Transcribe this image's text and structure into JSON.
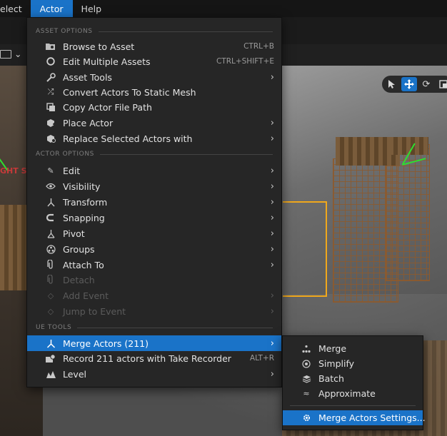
{
  "menubar": {
    "items": [
      {
        "label": "elect",
        "active": false
      },
      {
        "label": "Actor",
        "active": true
      },
      {
        "label": "Help",
        "active": false
      }
    ]
  },
  "viewport": {
    "overlay_text": "GHT SH",
    "tools": [
      "select-icon",
      "move-icon",
      "rotate-icon",
      "scale-icon"
    ]
  },
  "menu": {
    "sections": {
      "asset_options": "ASSET OPTIONS",
      "actor_options": "ACTOR OPTIONS",
      "ue_tools": "UE TOOLS"
    },
    "items": [
      {
        "label": "Browse to Asset",
        "shortcut": "CTRL+B",
        "icon": "folder-search-icon"
      },
      {
        "label": "Edit Multiple Assets",
        "shortcut": "CTRL+SHIFT+E",
        "icon": "circle-icon"
      },
      {
        "label": "Asset Tools",
        "icon": "wrench-icon",
        "submenu": true
      },
      {
        "label": "Convert Actors To Static Mesh",
        "icon": "convert-icon"
      },
      {
        "label": "Copy Actor File Path",
        "icon": "copy-icon"
      },
      {
        "label": "Place Actor",
        "icon": "place-actor-icon",
        "submenu": true
      },
      {
        "label": "Replace Selected Actors with",
        "icon": "replace-icon",
        "submenu": true
      },
      {
        "label": "Edit",
        "icon": "pencil-icon",
        "submenu": true
      },
      {
        "label": "Visibility",
        "icon": "eye-icon",
        "submenu": true
      },
      {
        "label": "Transform",
        "icon": "transform-icon",
        "submenu": true
      },
      {
        "label": "Snapping",
        "icon": "magnet-icon",
        "submenu": true
      },
      {
        "label": "Pivot",
        "icon": "pivot-icon",
        "submenu": true
      },
      {
        "label": "Groups",
        "icon": "groups-icon",
        "submenu": true
      },
      {
        "label": "Attach To",
        "icon": "paperclip-icon",
        "submenu": true
      },
      {
        "label": "Detach",
        "icon": "detach-icon",
        "disabled": true
      },
      {
        "label": "Add Event",
        "icon": "event-icon",
        "disabled": true,
        "submenu": true
      },
      {
        "label": "Jump to Event",
        "icon": "jump-icon",
        "disabled": true,
        "submenu": true
      },
      {
        "label": "Merge Actors (211)",
        "icon": "merge-icon",
        "submenu": true,
        "highlighted": true
      },
      {
        "label": "Record 211 actors with Take Recorder",
        "shortcut": "ALT+R",
        "icon": "record-icon"
      },
      {
        "label": "Level",
        "icon": "level-icon",
        "submenu": true
      }
    ]
  },
  "submenu": {
    "items": [
      {
        "label": "Merge",
        "icon": "merge-tree-icon"
      },
      {
        "label": "Simplify",
        "icon": "simplify-icon"
      },
      {
        "label": "Batch",
        "icon": "batch-icon"
      },
      {
        "label": "Approximate",
        "icon": "approximate-icon"
      },
      {
        "label": "Merge Actors Settings...",
        "icon": "settings-gear-icon",
        "highlighted": true
      }
    ]
  },
  "colors": {
    "accent": "#1a73c8",
    "menu_bg": "#262626",
    "selection": "#f0a81c",
    "gizmo": "#2ee02e"
  }
}
